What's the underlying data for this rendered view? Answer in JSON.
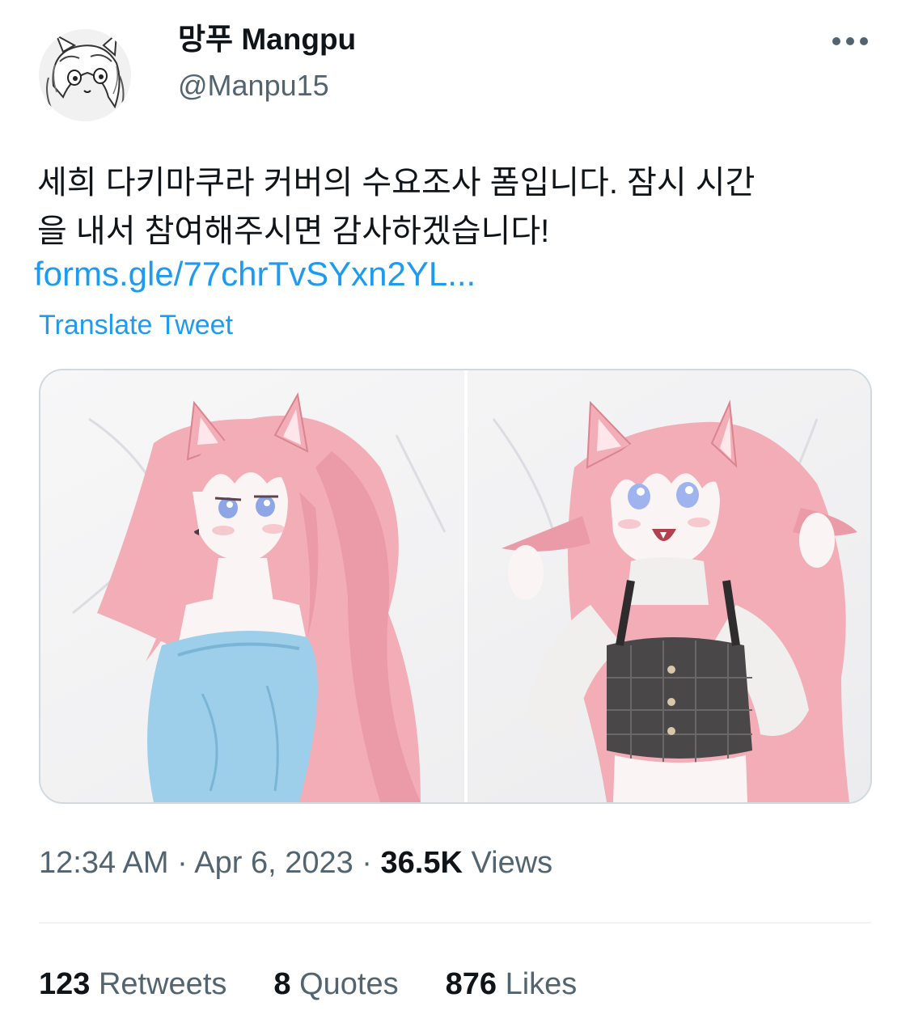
{
  "author": {
    "display_name": "망푸 Mangpu",
    "handle": "@Manpu15"
  },
  "header": {
    "more_icon": "more-horizontal-icon"
  },
  "tweet": {
    "text_line1": "세희 다키마쿠라 커버의 수요조사 폼입니다. 잠시 시간",
    "text_line2": "을 내서 참여해주시면 감사하겠습니다!",
    "link": "forms.gle/77chrTvSYxn2YL...",
    "translate_label": "Translate Tweet"
  },
  "meta": {
    "time": "12:34 AM",
    "separator": "·",
    "date": "Apr 6, 2023",
    "views_count": "36.5K",
    "views_label": "Views"
  },
  "stats": {
    "retweets_count": "123",
    "retweets_label": "Retweets",
    "quotes_count": "8",
    "quotes_label": "Quotes",
    "likes_count": "876",
    "likes_label": "Likes"
  },
  "colors": {
    "link": "#1d9bf0",
    "secondary_text": "#536471",
    "primary_text": "#0f1419",
    "hair": "#f2adb7",
    "sweater": "#9dcfeb",
    "plaid_top": "#4a4748"
  }
}
